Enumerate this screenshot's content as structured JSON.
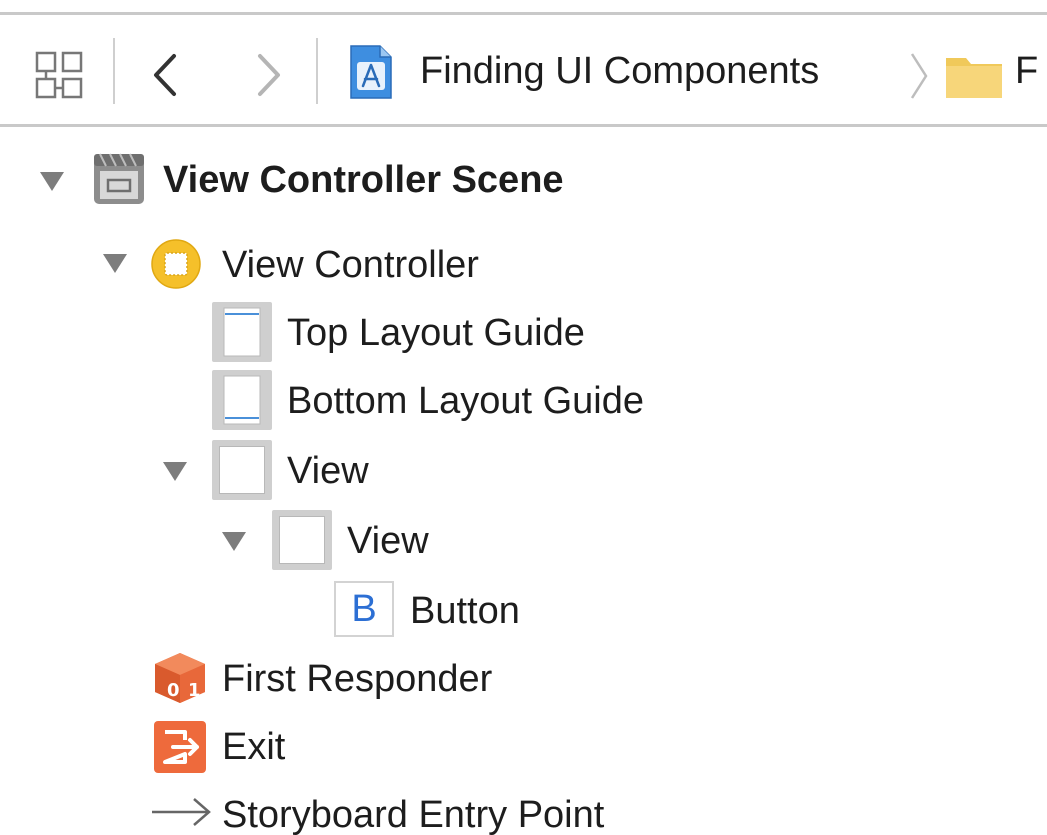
{
  "jump_bar": {
    "grid_icon": "related-items-grid-icon",
    "back_icon": "chevron-left-icon",
    "forward_icon": "chevron-right-icon",
    "crumbs": [
      {
        "label": "Finding UI Components",
        "icon": "xcode-project-icon"
      },
      {
        "label": "F",
        "icon": "folder-icon"
      }
    ]
  },
  "tree": {
    "scene": {
      "label": "View Controller Scene",
      "icon": "scene-icon"
    },
    "view_controller": {
      "label": "View Controller",
      "icon": "view-controller-icon"
    },
    "top_layout_guide": {
      "label": "Top Layout Guide",
      "icon": "top-layout-guide-icon"
    },
    "bottom_layout_guide": {
      "label": "Bottom Layout Guide",
      "icon": "bottom-layout-guide-icon"
    },
    "view": {
      "label": "View",
      "icon": "view-icon"
    },
    "subview": {
      "label": "View",
      "icon": "view-icon"
    },
    "button": {
      "label": "Button",
      "glyph": "B",
      "icon": "button-icon"
    },
    "first_responder": {
      "label": "First Responder",
      "icon": "first-responder-icon"
    },
    "exit": {
      "label": "Exit",
      "icon": "exit-icon"
    },
    "entry_point": {
      "label": "Storyboard Entry Point",
      "icon": "arrow-right-icon"
    }
  },
  "colors": {
    "accent_blue": "#2c6fd4",
    "view_controller_yellow": "#f5c02a",
    "first_responder_orange": "#e8683a",
    "exit_orange": "#ee6a3c",
    "folder_yellow": "#f7d67a"
  }
}
